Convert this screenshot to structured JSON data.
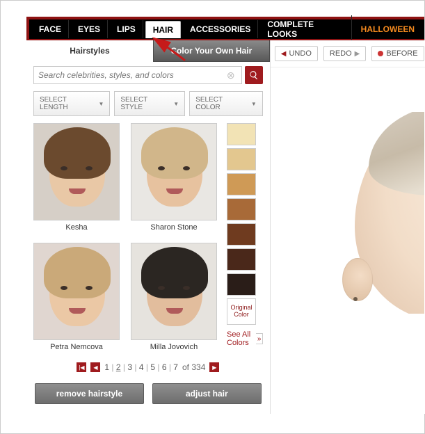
{
  "tabs": [
    "FACE",
    "EYES",
    "LIPS",
    "HAIR",
    "ACCESSORIES",
    "COMPLETE LOOKS",
    "HALLOWEEN"
  ],
  "active_tab": "HAIR",
  "subheader": {
    "left": "Hairstyles",
    "right": "Color Your Own Hair"
  },
  "search": {
    "placeholder": "Search celebrities, styles, and colors"
  },
  "filters": {
    "length": "SELECT LENGTH",
    "style": "SELECT STYLE",
    "color": "SELECT COLOR"
  },
  "hairstyles": [
    {
      "name": "Kesha",
      "bg": "#d6cfc7",
      "hair": "#6b4a2e",
      "skin": "#e9c8a6"
    },
    {
      "name": "Sharon Stone",
      "bg": "#e9e7e3",
      "hair": "#d1b68a",
      "skin": "#e7c29f"
    },
    {
      "name": "Petra Nemcova",
      "bg": "#e0d6d0",
      "hair": "#caa979",
      "skin": "#ebc8a5"
    },
    {
      "name": "Milla Jovovich",
      "bg": "#e6e3de",
      "hair": "#2b2622",
      "skin": "#e2bd9d"
    }
  ],
  "swatches": [
    "#f2e3b5",
    "#e3c78f",
    "#cf9a56",
    "#a86a38",
    "#6f3b1f",
    "#4a281a",
    "#2a1d18"
  ],
  "original_label": "Original Color",
  "see_all": "See All Colors",
  "pager": {
    "pages": [
      1,
      2,
      3,
      4,
      5,
      6,
      7
    ],
    "current": 2,
    "of_label": "of",
    "total": 334
  },
  "actions": {
    "remove": "remove hairstyle",
    "adjust": "adjust hair"
  },
  "right_controls": {
    "undo": "UNDO",
    "redo": "REDO",
    "before": "BEFORE"
  }
}
